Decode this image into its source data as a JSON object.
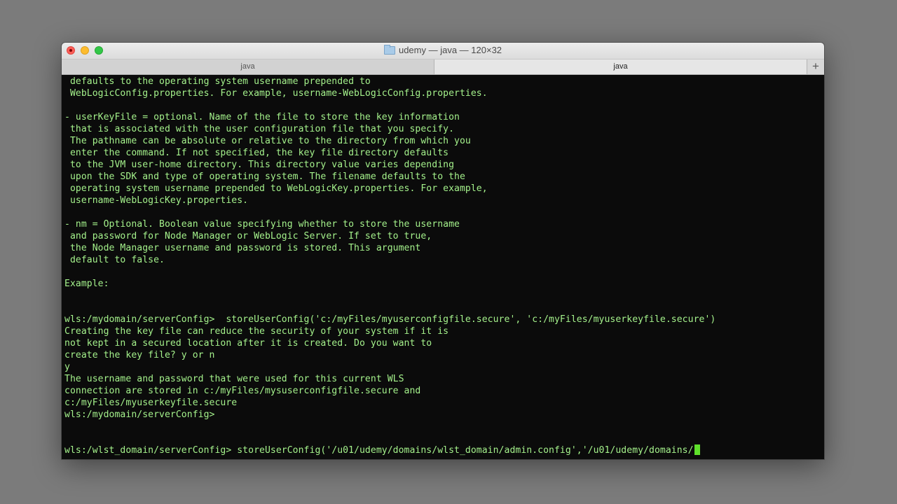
{
  "window": {
    "title": "udemy — java — 120×32"
  },
  "tabs": [
    {
      "label": "java",
      "active": false
    },
    {
      "label": "java",
      "active": true
    }
  ],
  "terminal": {
    "lines": [
      " defaults to the operating system username prepended to",
      " WebLogicConfig.properties. For example, username-WebLogicConfig.properties.",
      "",
      "- userKeyFile = optional. Name of the file to store the key information",
      " that is associated with the user configuration file that you specify.",
      " The pathname can be absolute or relative to the directory from which you",
      " enter the command. If not specified, the key file directory defaults",
      " to the JVM user-home directory. This directory value varies depending",
      " upon the SDK and type of operating system. The filename defaults to the",
      " operating system username prepended to WebLogicKey.properties. For example,",
      " username-WebLogicKey.properties.",
      "",
      "- nm = Optional. Boolean value specifying whether to store the username",
      " and password for Node Manager or WebLogic Server. If set to true,",
      " the Node Manager username and password is stored. This argument",
      " default to false.",
      "",
      "Example:",
      "",
      "",
      "wls:/mydomain/serverConfig>  storeUserConfig('c:/myFiles/myuserconfigfile.secure', 'c:/myFiles/myuserkeyfile.secure')",
      "Creating the key file can reduce the security of your system if it is",
      "not kept in a secured location after it is created. Do you want to",
      "create the key file? y or n",
      "y",
      "The username and password that were used for this current WLS",
      "connection are stored in c:/myFiles/mysuserconfigfile.secure and",
      "c:/myFiles/myuserkeyfile.secure",
      "wls:/mydomain/serverConfig>",
      "",
      ""
    ],
    "prompt_line": "wls:/wlst_domain/serverConfig> storeUserConfig('/u01/udemy/domains/wlst_domain/admin.config','/u01/udemy/domains/"
  },
  "colors": {
    "terminal_bg": "#0b0b0b",
    "terminal_text": "#a4f18b",
    "cursor": "#5ee02a"
  },
  "icons": [
    "close-icon",
    "minimize-icon",
    "zoom-icon",
    "folder-icon",
    "plus-icon"
  ]
}
